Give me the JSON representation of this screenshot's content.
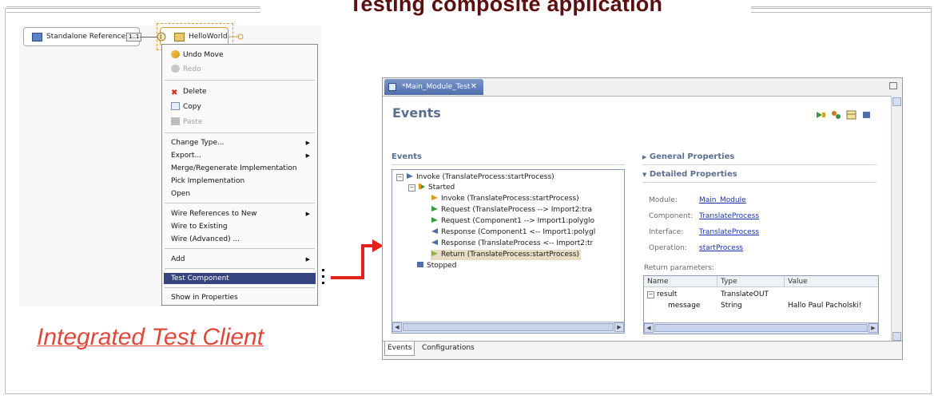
{
  "slide": {
    "title": "Testing composite application",
    "caption": "Integrated Test Client"
  },
  "diagram": {
    "standalone_node": "Standalone References",
    "standalone_badge": "1..1",
    "component_node": "HelloWorld"
  },
  "context_menu": {
    "items": [
      {
        "label": "Undo Move",
        "icon": "undo-icon",
        "disabled": false
      },
      {
        "label": "Redo",
        "icon": "redo-icon",
        "disabled": true
      },
      {
        "label": "Delete",
        "icon": "delete-icon",
        "disabled": false
      },
      {
        "label": "Copy",
        "icon": "copy-icon",
        "disabled": false
      },
      {
        "label": "Paste",
        "icon": "paste-icon",
        "disabled": true
      },
      {
        "label": "Change Type...",
        "submenu": true
      },
      {
        "label": "Export...",
        "submenu": true
      },
      {
        "label": "Merge/Regenerate Implementation"
      },
      {
        "label": "Pick Implementation"
      },
      {
        "label": "Open"
      },
      {
        "label": "Wire References to New",
        "submenu": true
      },
      {
        "label": "Wire to Existing"
      },
      {
        "label": "Wire (Advanced) ..."
      },
      {
        "label": "Add",
        "submenu": true
      },
      {
        "label": "Test Component",
        "selected": true
      },
      {
        "label": "Show in Properties"
      }
    ]
  },
  "editor": {
    "tab_label": "*Main_Module_Test",
    "header": "Events",
    "events_section": "Events",
    "general_props": "General Properties",
    "detailed_props": "Detailed Properties",
    "tree": [
      "Invoke (TranslateProcess:startProcess)",
      "Started",
      "Invoke (TranslateProcess:startProcess)",
      "Request (TranslateProcess --> Import2:tra",
      "Request (Component1 --> Import1:polyglo",
      "Response (Component1 <-- Import1:polygl",
      "Response (TranslateProcess <-- Import2:tr",
      "Return (TranslateProcess:startProcess)",
      "Stopped"
    ],
    "props": {
      "module_label": "Module:",
      "module_value": "Main_Module",
      "component_label": "Component:",
      "component_value": "TranslateProcess",
      "interface_label": "Interface:",
      "interface_value": "TranslateProcess",
      "operation_label": "Operation:",
      "operation_value": "startProcess"
    },
    "return_params_label": "Return parameters:",
    "return_table": {
      "headers": [
        "Name",
        "Type",
        "Value"
      ],
      "rows": [
        [
          "result",
          "TranslateOUT",
          ""
        ],
        [
          "message",
          "String",
          "Hallo Paul Pacholski!"
        ]
      ]
    },
    "bottom_tabs": [
      "Events",
      "Configurations"
    ]
  }
}
